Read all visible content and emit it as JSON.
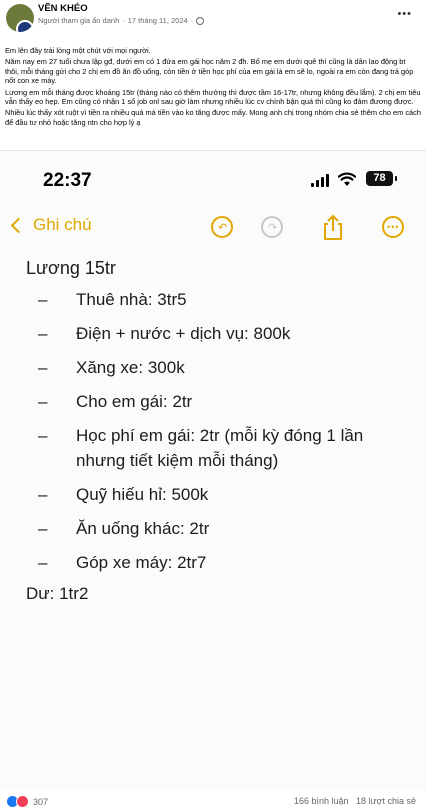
{
  "post": {
    "group_name": "VẼN KHÉO",
    "author": "Người tham gia ẩn danh",
    "date": "17 tháng 11, 2024",
    "separator": "·",
    "paragraphs": [
      "Em lên đây trải lòng một chút với mọi người.",
      "Năm nay em 27 tuổi chưa lập gđ, dưới em có 1 đứa em gái học năm 2 đh. Bố mẹ em dưới quê thì cũng là dân lao động bt thôi, mỗi tháng gửi cho 2 chị em đồ ăn đồ uống, còn tiền ở tiền học phí của em gái là em sẽ lo, ngoài ra em còn đang trả góp nốt con xe máy.",
      "Lương em mỗi tháng được khoảng 15tr (tháng nào có thêm thưởng thì được tầm 16-17tr, nhưng không đều lắm). 2 chị em tiêu vẫn thấy eo hẹp. Em cũng có nhận 1 số job onl sau giờ làm nhưng nhiều lúc cv chính bận quá thì cũng ko đảm đương được.",
      "Nhiều lúc thấy xót ruột vì tiền ra nhiều quá mà tiền vào ko tăng được mấy. Mong anh chị trong nhóm chia sẻ thêm cho em cách để đầu tư nhỏ hoặc tăng ntn cho hợp lý ạ"
    ]
  },
  "status_bar": {
    "time": "22:37",
    "battery": "78"
  },
  "notes_nav": {
    "back_label": "Ghi chú"
  },
  "note": {
    "title": "Lương 15tr",
    "dash": "–",
    "items": [
      "Thuê nhà: 3tr5",
      "Điện + nước + dịch vụ: 800k",
      "Xăng xe: 300k",
      "Cho em gái: 2tr",
      "Học phí em gái: 2tr (mỗi kỳ đóng 1 lần nhưng tiết kiệm mỗi tháng)",
      "Quỹ hiếu hỉ: 500k",
      "Ăn uống khác: 2tr",
      "Góp xe máy: 2tr7"
    ],
    "remainder": "Dư: 1tr2"
  },
  "footer": {
    "reaction_count": "307",
    "comments": "166 bình luận",
    "shares": "18 lượt chia sẻ"
  },
  "colors": {
    "accent": "#e0a800",
    "like": "#1877f2",
    "love": "#f33e58"
  }
}
